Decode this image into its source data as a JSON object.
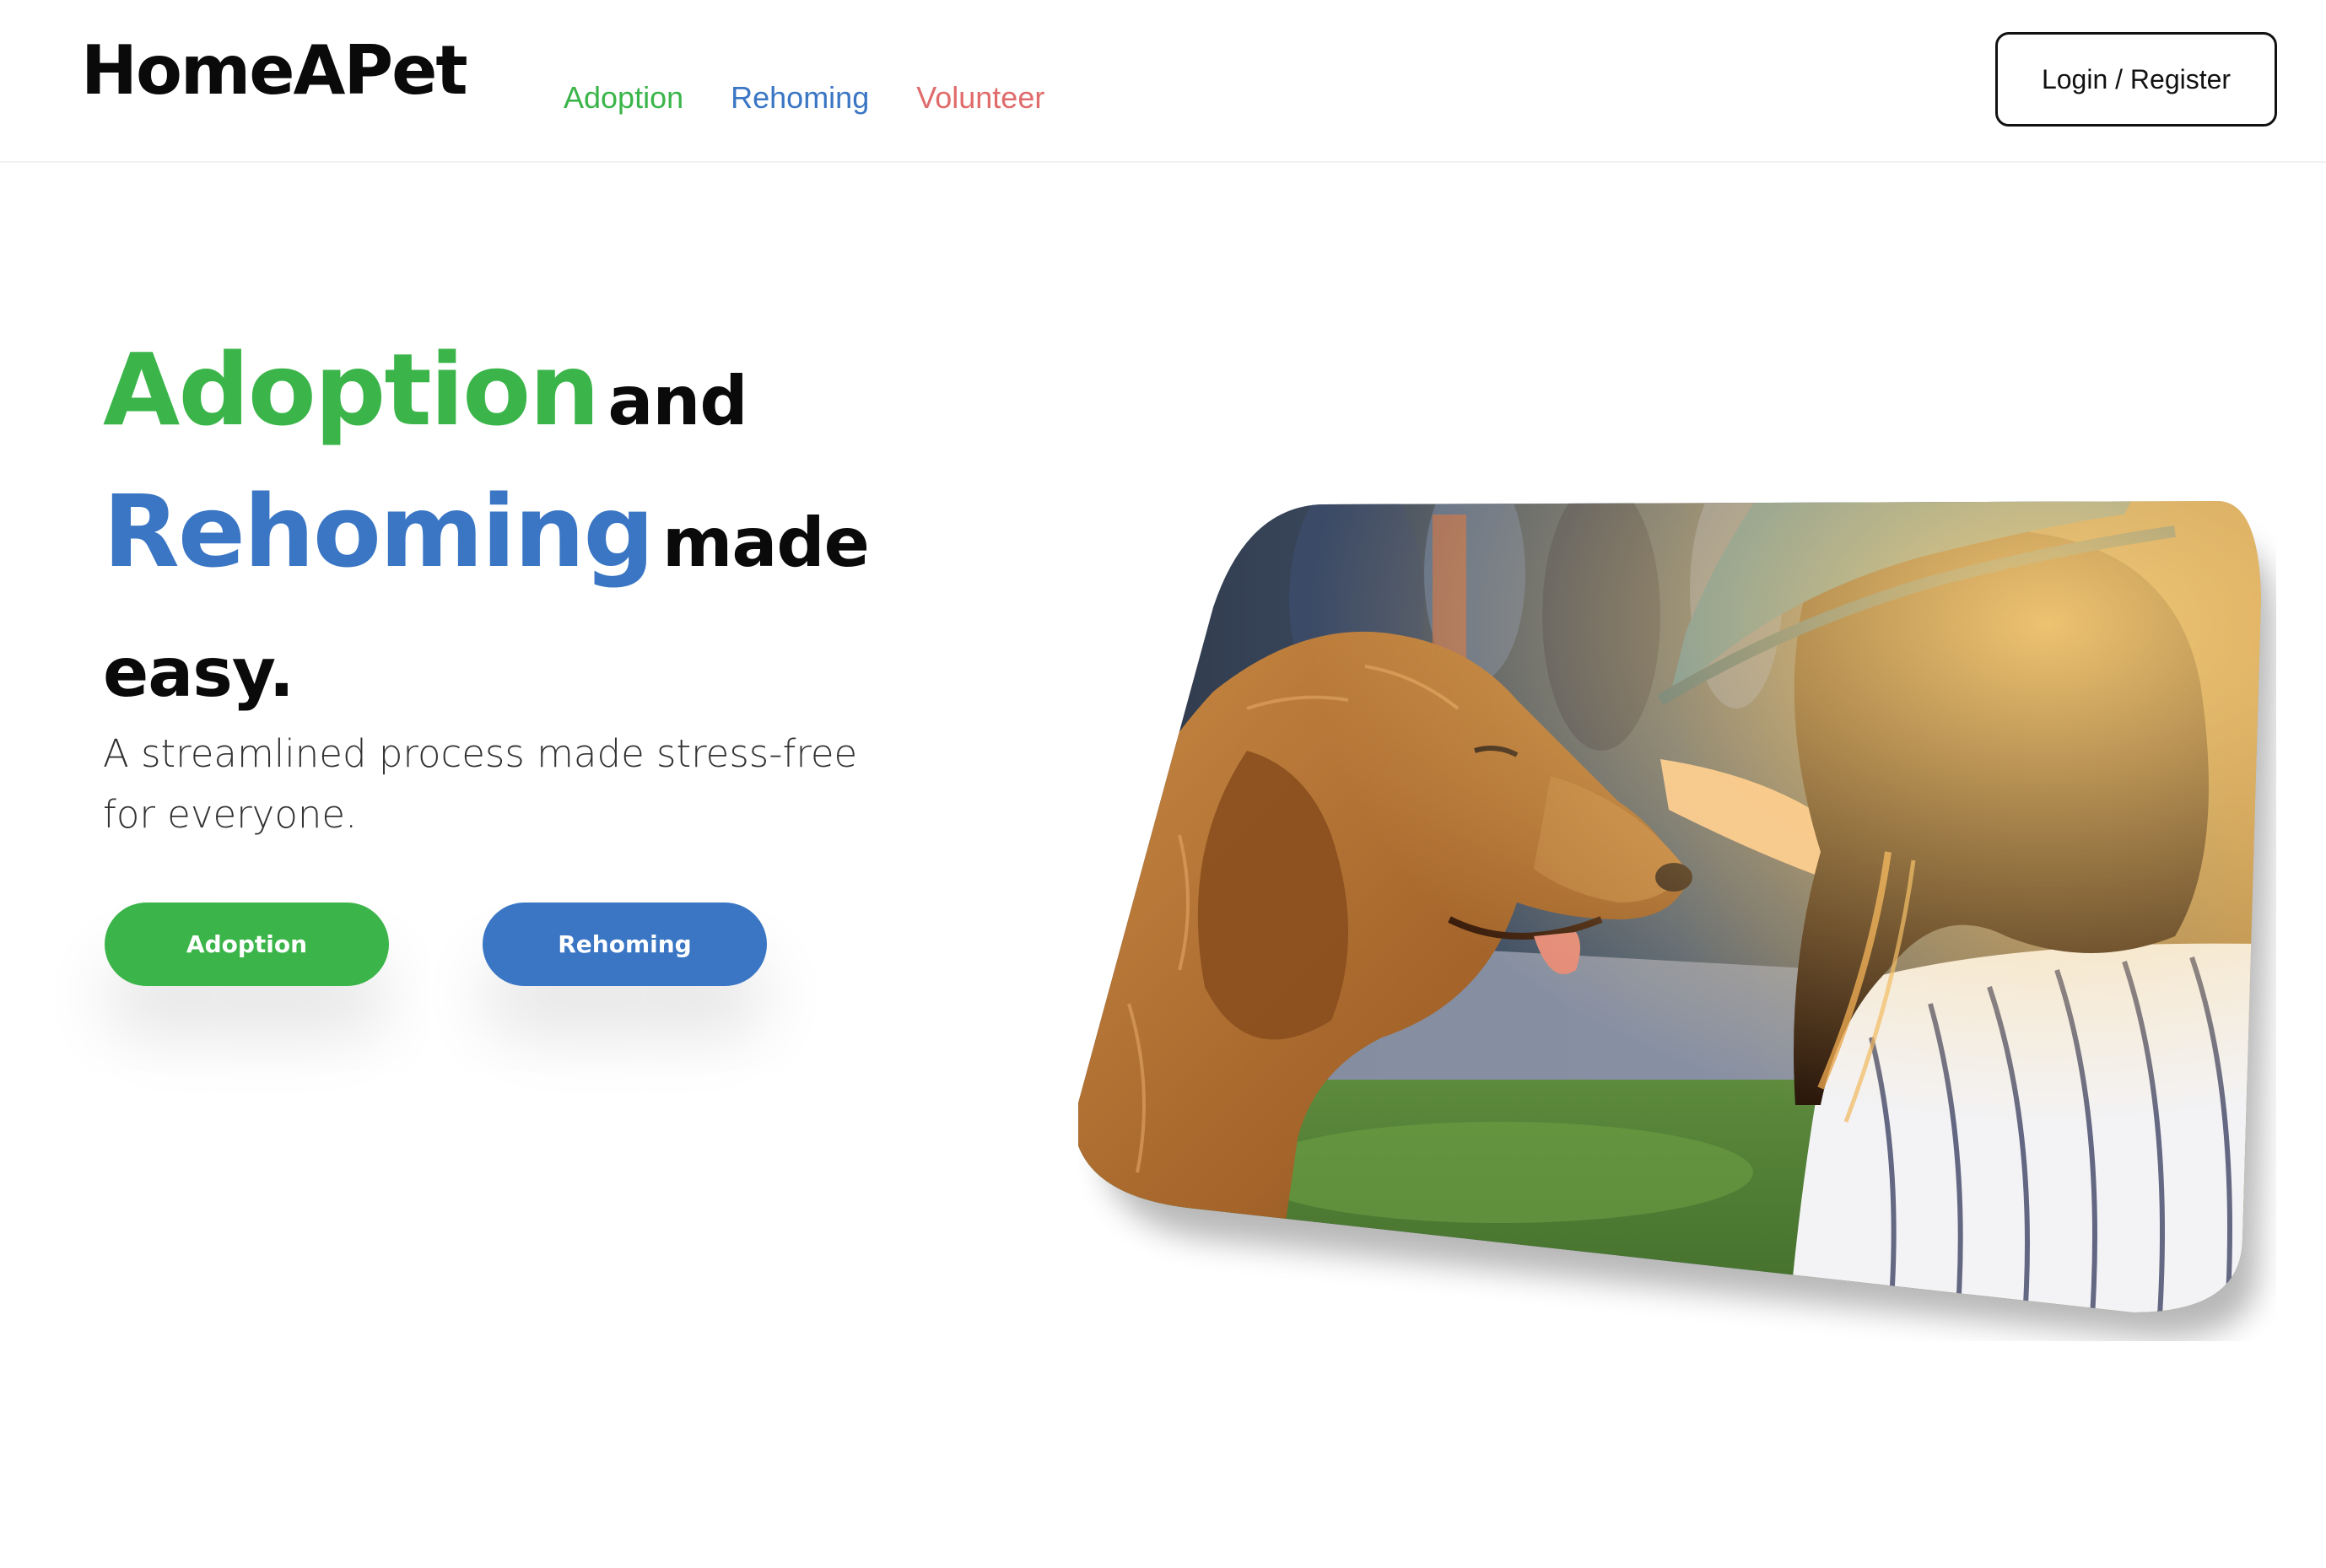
{
  "header": {
    "logo": "HomeAPet",
    "nav": [
      {
        "label": "Adoption",
        "color": "#3bb54a"
      },
      {
        "label": "Rehoming",
        "color": "#3a76c4"
      },
      {
        "label": "Volunteer",
        "color": "#e06b6b"
      }
    ],
    "login_label": "Login / Register"
  },
  "hero": {
    "title_word_1": "Adoption",
    "title_and": "and",
    "title_word_2": "Rehoming",
    "title_made": "made",
    "title_easy": "easy.",
    "subtitle": "A streamlined process made stress-free for everyone.",
    "buttons": [
      {
        "label": "Adoption",
        "color": "#3bb54a"
      },
      {
        "label": "Rehoming",
        "color": "#3a76c4"
      }
    ],
    "accent_green": "#3bb54a",
    "accent_blue": "#3a76c4"
  }
}
